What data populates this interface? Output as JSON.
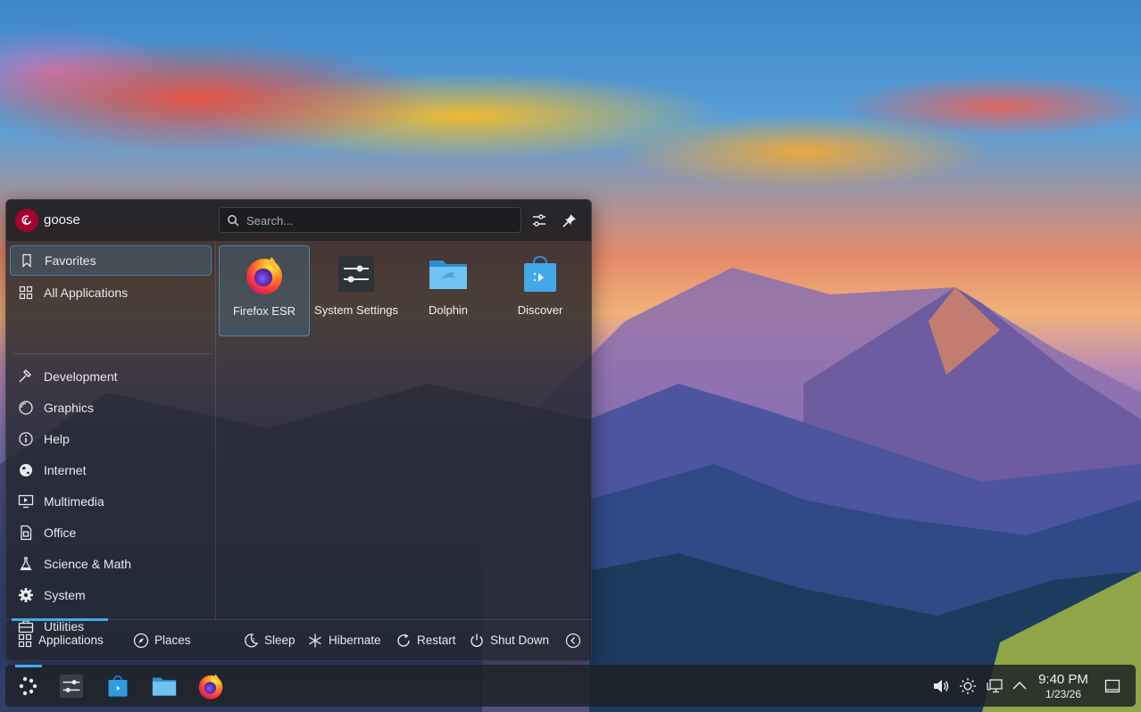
{
  "user": {
    "name": "goose"
  },
  "search": {
    "placeholder": "Search..."
  },
  "header": {
    "configure_icon": "sliders-icon",
    "pin_icon": "pin-icon"
  },
  "sidebar": {
    "items": [
      {
        "label": "Favorites",
        "icon": "bookmark-icon"
      },
      {
        "label": "All Applications",
        "icon": "grid-icon"
      },
      {
        "label": "Development",
        "icon": "hammer-icon"
      },
      {
        "label": "Graphics",
        "icon": "palette-icon"
      },
      {
        "label": "Help",
        "icon": "info-icon"
      },
      {
        "label": "Internet",
        "icon": "globe-icon"
      },
      {
        "label": "Multimedia",
        "icon": "monitor-play-icon"
      },
      {
        "label": "Office",
        "icon": "document-icon"
      },
      {
        "label": "Science & Math",
        "icon": "flask-icon"
      },
      {
        "label": "System",
        "icon": "gear-icon"
      },
      {
        "label": "Utilities",
        "icon": "toolbox-icon"
      }
    ]
  },
  "favorites": [
    {
      "label": "Firefox ESR",
      "icon": "firefox-icon"
    },
    {
      "label": "System Settings",
      "icon": "settings-app-icon"
    },
    {
      "label": "Dolphin",
      "icon": "folder-icon"
    },
    {
      "label": "Discover",
      "icon": "shopping-bag-icon"
    }
  ],
  "footer": {
    "tabs": [
      {
        "label": "Applications",
        "icon": "grid-icon"
      },
      {
        "label": "Places",
        "icon": "compass-icon"
      }
    ],
    "actions": [
      {
        "label": "Sleep",
        "icon": "moon-icon"
      },
      {
        "label": "Hibernate",
        "icon": "snowflake-icon"
      },
      {
        "label": "Restart",
        "icon": "restart-icon"
      },
      {
        "label": "Shut Down",
        "icon": "power-icon"
      }
    ],
    "more_icon": "chevron-left-icon"
  },
  "taskbar": {
    "launchers": [
      "kde-launcher-icon",
      "settings-app-icon",
      "shopping-bag-icon",
      "folder-icon",
      "firefox-icon"
    ],
    "tray": [
      "volume-icon",
      "brightness-icon",
      "network-icon",
      "chevron-up-icon"
    ],
    "clock": {
      "time": "9:40 PM",
      "date": "1/23/26"
    },
    "show_desktop_icon": "show-desktop-icon"
  },
  "colors": {
    "accent": "#3daee9",
    "debian_red": "#a80030"
  }
}
